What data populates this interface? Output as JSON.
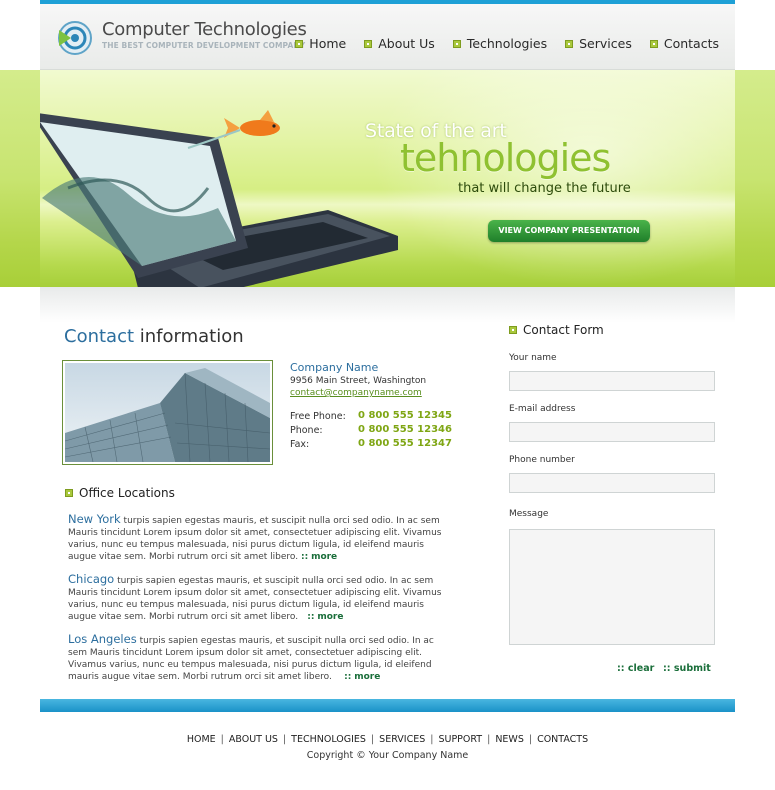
{
  "header": {
    "title": "Computer Technologies",
    "tagline": "THE BEST COMPUTER DEVELOPMENT COMPANY",
    "nav": [
      "Home",
      "About Us",
      "Technologies",
      "Services",
      "Contacts"
    ]
  },
  "banner": {
    "line1": "State of the art",
    "line2": "tehnologies",
    "line3": "that will change the future",
    "button": "VIEW COMPANY PRESENTATION"
  },
  "contact": {
    "heading_accent": "Contact",
    "heading_rest": "information",
    "company_name": "Company Name",
    "address": "9956 Main Street, Washington",
    "email": "contact@companyname.com",
    "phones": [
      {
        "label": "Free Phone:",
        "value": "0 800 555 12345"
      },
      {
        "label": "Phone:",
        "value": "0 800 555 12346"
      },
      {
        "label": "Fax:",
        "value": "0 800 555 12347"
      }
    ]
  },
  "offices": {
    "title": "Office Locations",
    "more_label": "more",
    "items": [
      {
        "city": "New York",
        "text": "turpis sapien egestas mauris, et suscipit nulla orci sed odio. In ac sem Mauris tincidunt Lorem ipsum dolor sit amet, consectetuer adipiscing elit. Vivamus varius, nunc eu tempus malesuada, nisi purus dictum ligula, id eleifend mauris augue vitae sem. Morbi rutrum orci sit amet libero."
      },
      {
        "city": "Chicago",
        "text": "turpis sapien egestas mauris, et suscipit nulla orci sed odio. In ac sem Mauris tincidunt Lorem ipsum dolor sit amet, consectetuer adipiscing elit. Vivamus varius, nunc eu tempus malesuada, nisi purus dictum ligula, id eleifend mauris augue vitae sem. Morbi rutrum orci sit amet libero."
      },
      {
        "city": "Los Angeles",
        "text": "turpis sapien egestas mauris, et suscipit nulla orci sed odio. In ac sem Mauris tincidunt Lorem ipsum dolor sit amet, consectetuer adipiscing elit. Vivamus varius, nunc eu tempus malesuada, nisi purus dictum ligula, id eleifend mauris augue vitae sem. Morbi rutrum orci sit amet libero."
      }
    ]
  },
  "form": {
    "title": "Contact Form",
    "labels": [
      "Your name",
      "E-mail address",
      "Phone number",
      "Message"
    ],
    "clear": "clear",
    "submit": "submit"
  },
  "footer": {
    "links": [
      "HOME",
      "ABOUT US",
      "TECHNOLOGIES",
      "SERVICES",
      "SUPPORT",
      "NEWS",
      "CONTACTS"
    ],
    "copyright": "Copyright © Your Company Name"
  },
  "colors": {
    "accent_blue": "#2c6e9e",
    "accent_green": "#a9c83c",
    "top_bar": "#1ea0d6"
  }
}
